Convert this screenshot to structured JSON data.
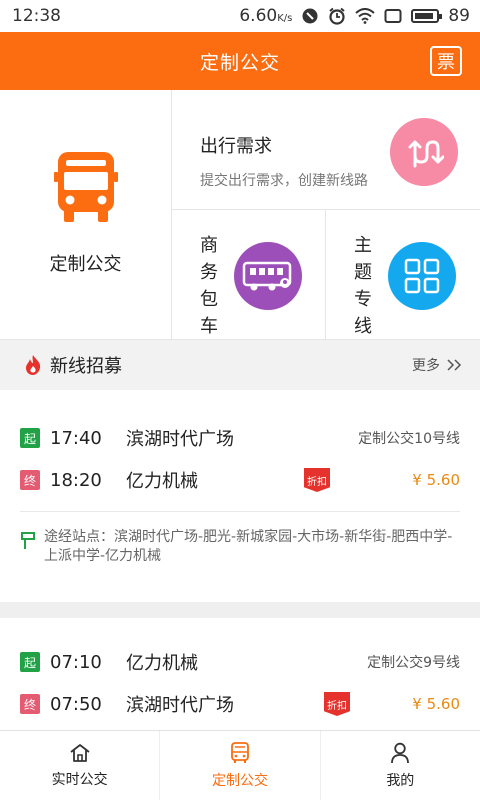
{
  "status_bar": {
    "time": "12:38",
    "net_speed": "6.60",
    "net_unit": "K/s",
    "battery": "89"
  },
  "header": {
    "title": "定制公交",
    "ticket_label": "票"
  },
  "features": {
    "custom_bus": {
      "label": "定制公交",
      "icon": "bus-icon",
      "color": "#fb6d10"
    },
    "travel_demand": {
      "title": "出行需求",
      "subtitle": "提交出行需求，创建新线路",
      "icon": "route-icon",
      "color": "#f78aa5"
    },
    "business_charter": {
      "label_chars": [
        "商",
        "务",
        "包",
        "车"
      ],
      "icon": "charter-bus-icon",
      "color": "#9c4fb8"
    },
    "theme_line": {
      "label_chars": [
        "主",
        "题",
        "专",
        "线"
      ],
      "icon": "grid-icon",
      "color": "#14a8ee"
    }
  },
  "new_lines": {
    "title": "新线招募",
    "more": "更多",
    "icon": "fire-icon"
  },
  "routes": [
    {
      "start_tag": "起",
      "start_time": "17:40",
      "start_stop": "滨湖时代广场",
      "line": "定制公交10号线",
      "end_tag": "终",
      "end_time": "18:20",
      "end_stop": "亿力机械",
      "discount": "折扣",
      "price": "¥ 5.60",
      "via": "途经站点：滨湖时代广场-肥光-新城家园-大市场-新华街-肥西中学-上派中学-亿力机械"
    },
    {
      "start_tag": "起",
      "start_time": "07:10",
      "start_stop": "亿力机械",
      "line": "定制公交9号线",
      "end_tag": "终",
      "end_time": "07:50",
      "end_stop": "滨湖时代广场",
      "discount": "折扣",
      "price": "¥ 5.60"
    }
  ],
  "bottom_nav": [
    {
      "label": "实时公交",
      "icon": "home-icon",
      "active": false
    },
    {
      "label": "定制公交",
      "icon": "bus-tab-icon",
      "active": true
    },
    {
      "label": "我的",
      "icon": "user-icon",
      "active": false
    }
  ],
  "colors": {
    "brand": "#fb6d10",
    "start_tag": "#22a247",
    "end_tag": "#e55b72",
    "price": "#e88a14",
    "discount": "#e5322d"
  }
}
